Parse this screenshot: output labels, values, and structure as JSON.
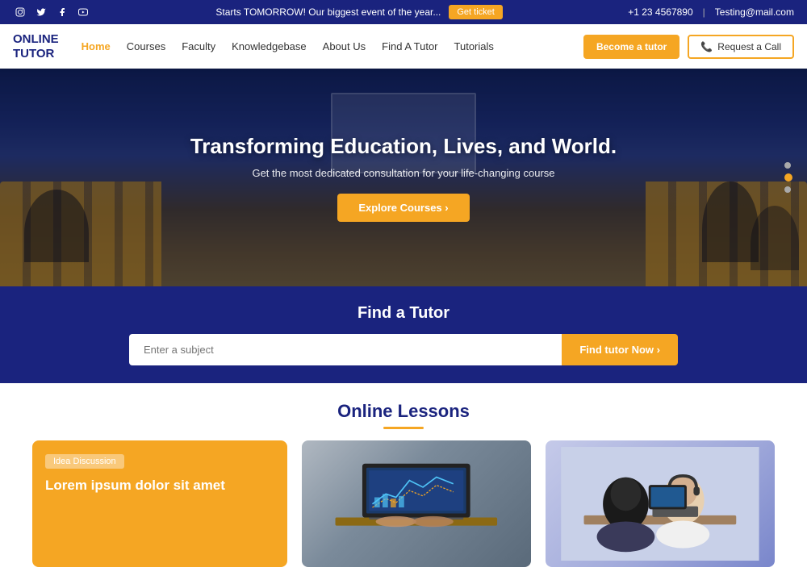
{
  "topbar": {
    "announcement": "Starts TOMORROW! Our biggest event of the year...",
    "get_ticket_label": "Get ticket",
    "phone": "+1 23 4567890",
    "email": "Testing@mail.com",
    "social": [
      "instagram",
      "twitter",
      "facebook",
      "youtube"
    ]
  },
  "navbar": {
    "logo_line1": "ONLINE",
    "logo_line2": "TUTOR",
    "links": [
      {
        "label": "Home",
        "active": true
      },
      {
        "label": "Courses",
        "active": false
      },
      {
        "label": "Faculty",
        "active": false
      },
      {
        "label": "Knowledgebase",
        "active": false
      },
      {
        "label": "About Us",
        "active": false
      },
      {
        "label": "Find A Tutor",
        "active": false
      },
      {
        "label": "Tutorials",
        "active": false
      }
    ],
    "btn_become": "Become a tutor",
    "btn_request": "Request a Call"
  },
  "hero": {
    "title": "Transforming Education, Lives, and World.",
    "subtitle": "Get the most dedicated consultation for your life-changing course",
    "cta_label": "Explore Courses"
  },
  "find_tutor": {
    "title": "Find a Tutor",
    "input_placeholder": "Enter a subject",
    "btn_label": "Find tutor Now"
  },
  "lessons": {
    "title": "Online Lessons",
    "card1_tag": "Idea Discussion",
    "card1_text": "Lorem ipsum dolor sit amet",
    "card2_alt": "Laptop analytics screen",
    "card3_alt": "Students studying together"
  },
  "slider_dots": [
    false,
    true,
    false
  ]
}
